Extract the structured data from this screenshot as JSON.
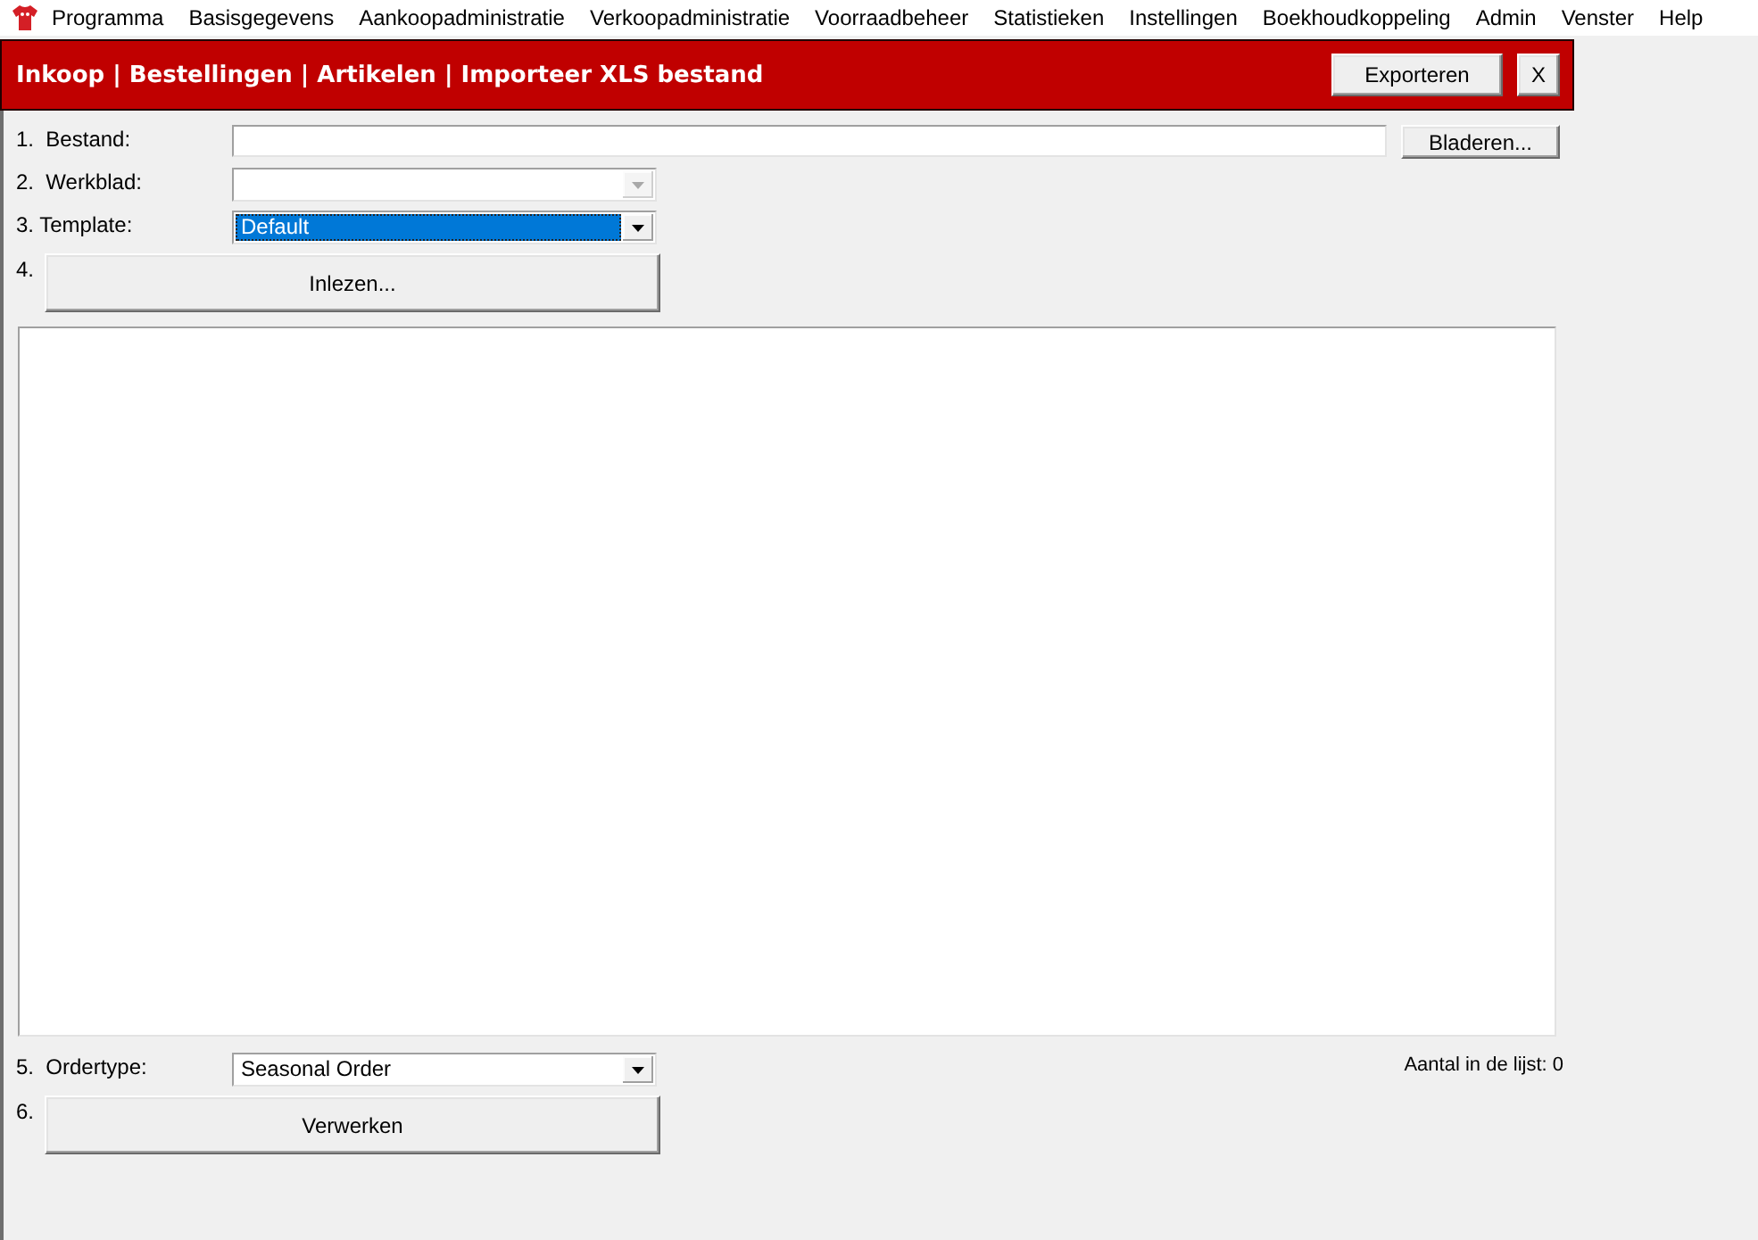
{
  "menu_bar": {
    "items": [
      "Programma",
      "Basisgegevens",
      "Aankoopadministratie",
      "Verkoopadministratie",
      "Voorraadbeheer",
      "Statistieken",
      "Instellingen",
      "Boekhoudkoppeling",
      "Admin",
      "Venster",
      "Help"
    ]
  },
  "header": {
    "title": "Inkoop | Bestellingen | Artikelen | Importeer XLS bestand",
    "buttons": [
      "Exporteren",
      "X"
    ]
  },
  "steps": [
    {
      "kind": "file",
      "label": "1.  Bestand:",
      "button": "Bladeren..."
    },
    {
      "kind": "combo",
      "label": "2.  Werkblad:",
      "disabled": true,
      "focused": false
    },
    {
      "kind": "combo",
      "label": "3. Template:",
      "value": "Default",
      "disabled": false,
      "focused": true
    },
    {
      "kind": "button",
      "label": "4.",
      "button": "Inlezen..."
    }
  ],
  "footer": {
    "steps": [
      {
        "kind": "combo",
        "label": "5.  Ordertype:",
        "value": "Seasonal Order",
        "disabled": false,
        "focused": false
      },
      {
        "kind": "button",
        "label": "6.",
        "button": "Verwerken"
      }
    ],
    "count": "Aantal in de lijst: 0"
  }
}
